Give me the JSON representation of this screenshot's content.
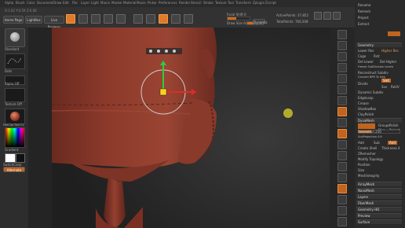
{
  "app": {
    "version_line": "ZBrush",
    "coordinates": "X:1.02  Y:0.59  Z:0.06"
  },
  "menu": {
    "items": [
      "Alpha",
      "Brush",
      "Color",
      "Document",
      "Draw",
      "Edit",
      "File",
      "Layer",
      "Light",
      "Macro",
      "Marker",
      "Material",
      "Movie",
      "Picker",
      "Preferences",
      "Render",
      "Stencil",
      "Stroke",
      "Texture",
      "Tool",
      "Transform",
      "Zplugin",
      "Zscript"
    ]
  },
  "top": {
    "buttons": {
      "home": "Home Page",
      "lightbox": "LightBox",
      "live_boolean": "Live Boolean"
    },
    "tools": {
      "edit": "Edit",
      "draw": "Draw",
      "move": "Move",
      "scale": "Scale",
      "rotate": "Rotate"
    },
    "focal_shift": "Focal Shift 0",
    "draw_size": "Draw Size 64",
    "dynamic": "Dynamic",
    "active_points": "ActivePoints: 37,852",
    "total_points": "TotalPoints: 766,508"
  },
  "left_shelf": {
    "brush_label": "Standard",
    "stroke_label": "Dots",
    "alpha_label": "Alpha Off",
    "texture_label": "Texture Off",
    "material_label": "MatCap Red 01",
    "gradient": "Gradient",
    "switch_color": "SwitchColor",
    "alternate": "Alternate"
  },
  "right_shelf": {
    "labels": [
      "BPR",
      "SPix 3",
      "Scroll",
      "Zoom",
      "Actual",
      "AAHalf",
      "Persp",
      "Floor",
      "L.Sym",
      "Gxyz",
      "Frame",
      "Move",
      "Scale",
      "Rotate",
      "Line Fill",
      "Transp",
      "Solo",
      "Xpose"
    ]
  },
  "right_panel": {
    "top_items": [
      "Rename",
      "Remesh",
      "Project",
      "Extract"
    ],
    "geometry_header": "Geometry",
    "geometry_items": [
      "Lower Res",
      "Higher Res",
      "Cage",
      "Rstr",
      "Del Lower",
      "Del Higher",
      "Freeze SubDivision Levels",
      "Reconstruct Subdiv",
      "Convert BPR To Geo",
      "Divide",
      "Smt",
      "Suv",
      "ReUV",
      "Dynamic Subdiv",
      "EdgeLoop",
      "Crease",
      "ShadowBox",
      "ClayPolish"
    ],
    "dynamesh_header": "DynaMesh",
    "dynamesh_items": [
      "Groups",
      "Polish",
      "Blur",
      "Project",
      "Resolution 256",
      "SubProjection 0.6",
      "Add",
      "Sub",
      "And",
      "Create Shell",
      "Thickness 4",
      "ZRemesher",
      "Modify Topology",
      "Position",
      "Size",
      "MeshIntegrity"
    ],
    "bottom_items": [
      "ArrayMesh",
      "NanoMesh",
      "Layers",
      "FiberMesh",
      "Geometry HD",
      "Preview",
      "Surface"
    ]
  },
  "accents": {
    "orange": "#e07a28",
    "clay": "#8a3a2c",
    "gizmo_x": "#e02a2a",
    "gizmo_y": "#2ecc40",
    "gizmo_z": "#ffd21f"
  }
}
